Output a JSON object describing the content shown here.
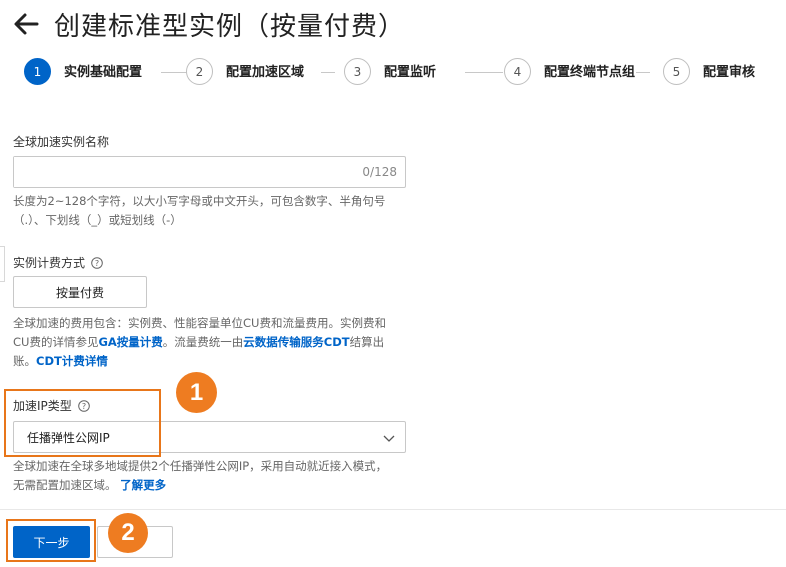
{
  "header": {
    "title": "创建标准型实例（按量付费）"
  },
  "steps": [
    {
      "number": "1",
      "label": "实例基础配置",
      "active": true
    },
    {
      "number": "2",
      "label": "配置加速区域",
      "active": false
    },
    {
      "number": "3",
      "label": "配置监听",
      "active": false
    },
    {
      "number": "4",
      "label": "配置终端节点组",
      "active": false
    },
    {
      "number": "5",
      "label": "配置审核",
      "active": false
    }
  ],
  "instance_name": {
    "label": "全球加速实例名称",
    "value": "",
    "char_count": "0/128",
    "hint_line1": "长度为2~128个字符，以大小写字母或中文开头，可包含数字、半角句号",
    "hint_line2": "（.）、下划线（_）或短划线（-）"
  },
  "billing": {
    "label": "实例计费方式",
    "option": "按量付费",
    "hint_line1": "全球加速的费用包含：实例费、性能容量单位CU费和流量费用。实例费和",
    "hint_line2_a": "CU费的详情参见",
    "hint_link_ga": "GA按量计费",
    "hint_line2_b": "。流量费统一由",
    "hint_link_cdt": "云数据传输服务CDT",
    "hint_line2_c": "结算出",
    "hint_line3_a": "账。",
    "hint_link_cdt_detail": "CDT计费详情"
  },
  "ip_type": {
    "label": "加速IP类型",
    "selected": "任播弹性公网IP",
    "hint_line1": "全球加速在全球多地域提供2个任播弹性公网IP，采用自动就近接入模式，",
    "hint_line2": "无需配置加速区域。",
    "hint_link": "了解更多"
  },
  "annotations": {
    "badge_1": "1",
    "badge_2": "2"
  },
  "footer": {
    "next_label": "下一步",
    "cancel_label": ""
  },
  "colors": {
    "primary": "#0064c8",
    "annotation": "#ee7c21"
  }
}
